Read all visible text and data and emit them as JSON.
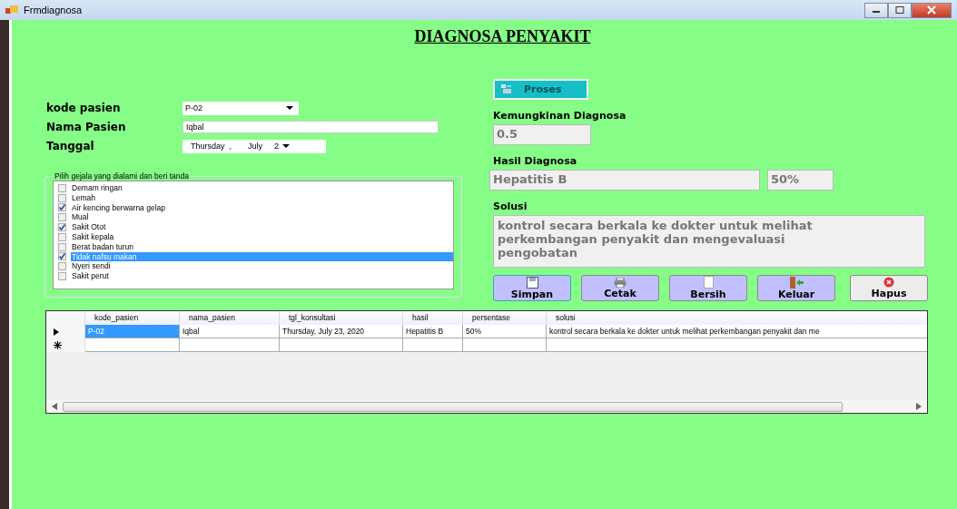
{
  "window": {
    "title": "Frmdiagnosa"
  },
  "heading": "DIAGNOSA PENYAKIT",
  "form": {
    "kode_label": "kode pasien",
    "kode_value": "P-02",
    "nama_label": "Nama Pasien",
    "nama_value": "Iqbal",
    "tanggal_label": "Tanggal",
    "tanggal_day": "Thursday",
    "tanggal_sep": ",",
    "tanggal_month": "July",
    "tanggal_date": "2"
  },
  "symptoms": {
    "title": "Pilih gejala yang dialami dan beri tanda",
    "items": [
      {
        "label": "Demam ringan",
        "checked": false,
        "selected": false
      },
      {
        "label": "Lemah",
        "checked": false,
        "selected": false
      },
      {
        "label": "Air kencing berwarna gelap",
        "checked": true,
        "selected": false
      },
      {
        "label": "Mual",
        "checked": false,
        "selected": false
      },
      {
        "label": "Sakit Otot",
        "checked": true,
        "selected": false
      },
      {
        "label": "Sakit kepala",
        "checked": false,
        "selected": false
      },
      {
        "label": "Berat badan turun",
        "checked": false,
        "selected": false
      },
      {
        "label": "Tidak nafsu makan",
        "checked": true,
        "selected": true
      },
      {
        "label": "Nyeri sendi",
        "checked": false,
        "selected": false
      },
      {
        "label": "Sakit perut",
        "checked": false,
        "selected": false
      }
    ]
  },
  "proses_button": "Proses",
  "result": {
    "kemungkinan_label": "Kemungkinan Diagnosa",
    "kemungkinan_value": "0.5",
    "hasil_label": "Hasil Diagnosa",
    "hasil_value": "Hepatitis B",
    "persen_value": "50%",
    "solusi_label": "Solusi",
    "solusi_value": "kontrol secara berkala ke dokter untuk melihat perkembangan penyakit dan mengevaluasi pengobatan"
  },
  "buttons": [
    {
      "label": "Simpan",
      "kind": "save"
    },
    {
      "label": "Cetak",
      "kind": "print"
    },
    {
      "label": "Bersih",
      "kind": "clear"
    },
    {
      "label": "Keluar",
      "kind": "exit"
    },
    {
      "label": "Hapus",
      "kind": "delete"
    }
  ],
  "table": {
    "columns": [
      "kode_pasien",
      "nama_pasien",
      "tgl_konsultasi",
      "hasil",
      "persentase",
      "solusi"
    ],
    "rows": [
      {
        "kind": "current",
        "cells": [
          {
            "text": "P-02",
            "selected": true
          },
          {
            "text": "Iqbal",
            "selected": false
          },
          {
            "text": "Thursday, July 23, 2020",
            "selected": false
          },
          {
            "text": "Hepatitis B",
            "selected": false
          },
          {
            "text": "50%",
            "selected": false
          },
          {
            "text": "kontrol secara berkala ke dokter untuk melihat perkembangan penyakit dan me",
            "selected": false
          }
        ]
      },
      {
        "kind": "new"
      }
    ]
  }
}
